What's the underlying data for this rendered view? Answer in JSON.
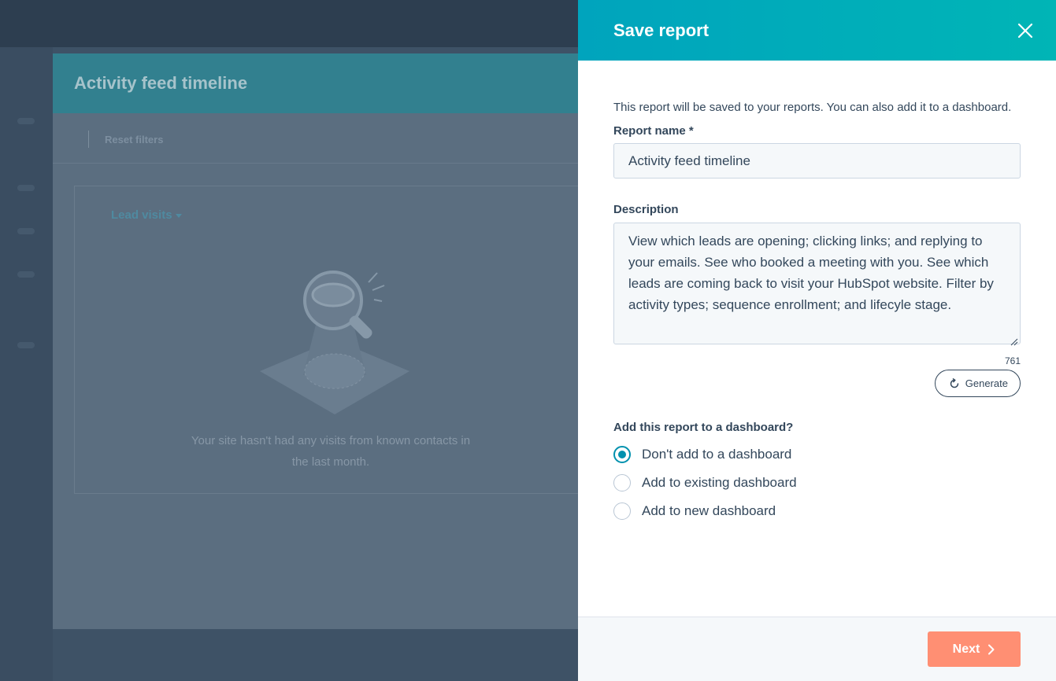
{
  "background": {
    "modal_title": "Activity feed timeline",
    "reset_filters": "Reset filters",
    "lead_visits": "Lead visits",
    "empty_text": "Your site hasn't had any visits from known contacts in the last month."
  },
  "panel": {
    "title": "Save report",
    "intro": "This report will be saved to your reports. You can also add it to a dashboard.",
    "report_name_label": "Report name *",
    "report_name_value": "Activity feed timeline",
    "description_label": "Description",
    "description_value": "View which leads are opening; clicking links; and replying to your emails. See who booked a meeting with you. See which leads are coming back to visit your HubSpot website. Filter by activity types; sequence enrollment; and lifecyle stage.",
    "char_count": "761",
    "generate_label": "Generate",
    "dashboard_question": "Add this report to a dashboard?",
    "dashboard_options": [
      {
        "label": "Don't add to a dashboard",
        "selected": true
      },
      {
        "label": "Add to existing dashboard",
        "selected": false
      },
      {
        "label": "Add to new dashboard",
        "selected": false
      }
    ],
    "next_label": "Next"
  },
  "colors": {
    "header_gradient_start": "#00a4bd",
    "header_gradient_end": "#00b5b6",
    "primary_button": "#ff8f73",
    "radio_accent": "#0091ae",
    "text": "#33475b"
  },
  "icons": {
    "close": "close-icon",
    "generate": "refresh-icon",
    "next": "chevron-right-icon",
    "empty_state": "magnifying-glass-illustration"
  }
}
